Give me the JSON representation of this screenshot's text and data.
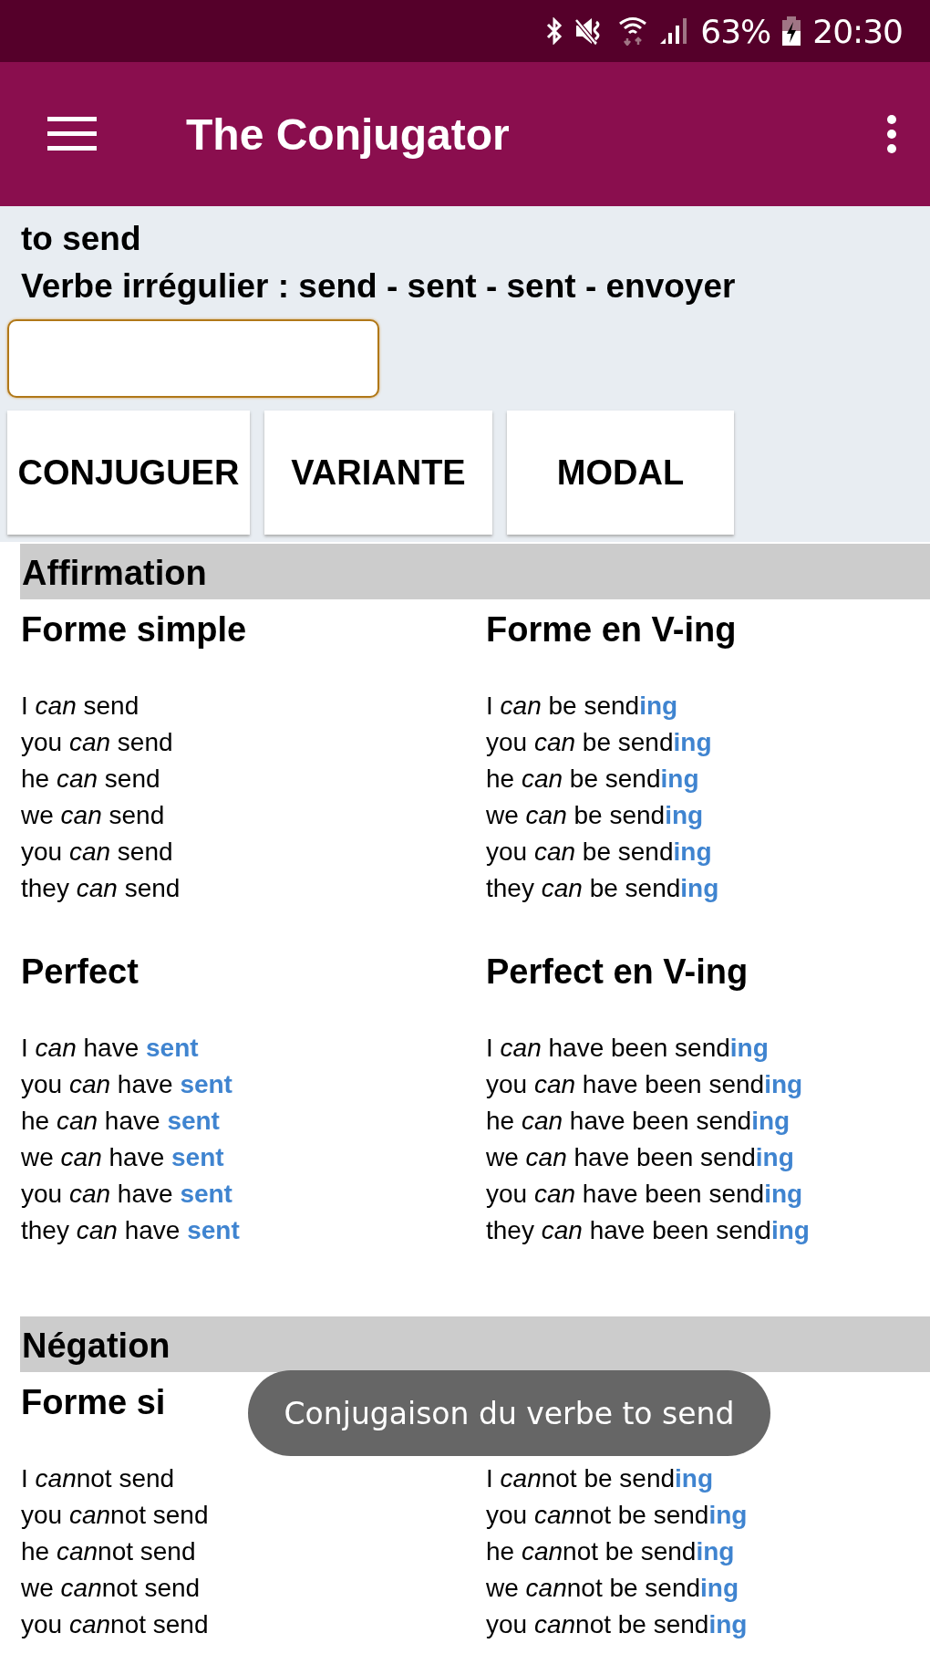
{
  "status_bar": {
    "battery": "63%",
    "time": "20:30"
  },
  "app_bar": {
    "title": "The Conjugator"
  },
  "verb": {
    "title": "to send",
    "info": "Verbe irrégulier : send - sent - sent - envoyer"
  },
  "buttons": [
    "CONJUGUER",
    "VARIANTE",
    "MODAL"
  ],
  "sections": [
    {
      "title": "Affirmation",
      "tenses": [
        {
          "title": "Forme simple",
          "lines": [
            [
              {
                "text": "I "
              },
              {
                "text": "can",
                "kind": "modal"
              },
              {
                "text": " send"
              }
            ],
            [
              {
                "text": "you "
              },
              {
                "text": "can",
                "kind": "modal"
              },
              {
                "text": " send"
              }
            ],
            [
              {
                "text": "he "
              },
              {
                "text": "can",
                "kind": "modal"
              },
              {
                "text": " send"
              }
            ],
            [
              {
                "text": "we "
              },
              {
                "text": "can",
                "kind": "modal"
              },
              {
                "text": " send"
              }
            ],
            [
              {
                "text": "you "
              },
              {
                "text": "can",
                "kind": "modal"
              },
              {
                "text": " send"
              }
            ],
            [
              {
                "text": "they "
              },
              {
                "text": "can",
                "kind": "modal"
              },
              {
                "text": " send"
              }
            ]
          ]
        },
        {
          "title": "Forme en V-ing",
          "lines": [
            [
              {
                "text": "I "
              },
              {
                "text": "can",
                "kind": "modal"
              },
              {
                "text": " be send"
              },
              {
                "text": "ing",
                "kind": "ending"
              }
            ],
            [
              {
                "text": "you "
              },
              {
                "text": "can",
                "kind": "modal"
              },
              {
                "text": " be send"
              },
              {
                "text": "ing",
                "kind": "ending"
              }
            ],
            [
              {
                "text": "he "
              },
              {
                "text": "can",
                "kind": "modal"
              },
              {
                "text": " be send"
              },
              {
                "text": "ing",
                "kind": "ending"
              }
            ],
            [
              {
                "text": "we "
              },
              {
                "text": "can",
                "kind": "modal"
              },
              {
                "text": " be send"
              },
              {
                "text": "ing",
                "kind": "ending"
              }
            ],
            [
              {
                "text": "you "
              },
              {
                "text": "can",
                "kind": "modal"
              },
              {
                "text": " be send"
              },
              {
                "text": "ing",
                "kind": "ending"
              }
            ],
            [
              {
                "text": "they "
              },
              {
                "text": "can",
                "kind": "modal"
              },
              {
                "text": " be send"
              },
              {
                "text": "ing",
                "kind": "ending"
              }
            ]
          ]
        },
        {
          "title": "Perfect",
          "lines": [
            [
              {
                "text": "I "
              },
              {
                "text": "can",
                "kind": "modal"
              },
              {
                "text": " have "
              },
              {
                "text": "sent",
                "kind": "ending"
              }
            ],
            [
              {
                "text": "you "
              },
              {
                "text": "can",
                "kind": "modal"
              },
              {
                "text": " have "
              },
              {
                "text": "sent",
                "kind": "ending"
              }
            ],
            [
              {
                "text": "he "
              },
              {
                "text": "can",
                "kind": "modal"
              },
              {
                "text": " have "
              },
              {
                "text": "sent",
                "kind": "ending"
              }
            ],
            [
              {
                "text": "we "
              },
              {
                "text": "can",
                "kind": "modal"
              },
              {
                "text": " have "
              },
              {
                "text": "sent",
                "kind": "ending"
              }
            ],
            [
              {
                "text": "you "
              },
              {
                "text": "can",
                "kind": "modal"
              },
              {
                "text": " have "
              },
              {
                "text": "sent",
                "kind": "ending"
              }
            ],
            [
              {
                "text": "they "
              },
              {
                "text": "can",
                "kind": "modal"
              },
              {
                "text": " have "
              },
              {
                "text": "sent",
                "kind": "ending"
              }
            ]
          ]
        },
        {
          "title": "Perfect en V-ing",
          "lines": [
            [
              {
                "text": "I "
              },
              {
                "text": "can",
                "kind": "modal"
              },
              {
                "text": " have been send"
              },
              {
                "text": "ing",
                "kind": "ending"
              }
            ],
            [
              {
                "text": "you "
              },
              {
                "text": "can",
                "kind": "modal"
              },
              {
                "text": " have been send"
              },
              {
                "text": "ing",
                "kind": "ending"
              }
            ],
            [
              {
                "text": "he "
              },
              {
                "text": "can",
                "kind": "modal"
              },
              {
                "text": " have been send"
              },
              {
                "text": "ing",
                "kind": "ending"
              }
            ],
            [
              {
                "text": "we "
              },
              {
                "text": "can",
                "kind": "modal"
              },
              {
                "text": " have been send"
              },
              {
                "text": "ing",
                "kind": "ending"
              }
            ],
            [
              {
                "text": "you "
              },
              {
                "text": "can",
                "kind": "modal"
              },
              {
                "text": " have been send"
              },
              {
                "text": "ing",
                "kind": "ending"
              }
            ],
            [
              {
                "text": "they "
              },
              {
                "text": "can",
                "kind": "modal"
              },
              {
                "text": " have been send"
              },
              {
                "text": "ing",
                "kind": "ending"
              }
            ]
          ]
        }
      ]
    },
    {
      "title": "Négation",
      "tenses": [
        {
          "title": "Forme si",
          "lines": [
            [
              {
                "text": "I "
              },
              {
                "text": "can",
                "kind": "modal"
              },
              {
                "text": "not send"
              }
            ],
            [
              {
                "text": "you "
              },
              {
                "text": "can",
                "kind": "modal"
              },
              {
                "text": "not send"
              }
            ],
            [
              {
                "text": "he "
              },
              {
                "text": "can",
                "kind": "modal"
              },
              {
                "text": "not send"
              }
            ],
            [
              {
                "text": "we "
              },
              {
                "text": "can",
                "kind": "modal"
              },
              {
                "text": "not send"
              }
            ],
            [
              {
                "text": "you "
              },
              {
                "text": "can",
                "kind": "modal"
              },
              {
                "text": "not send"
              }
            ]
          ]
        },
        {
          "lines": [
            [
              {
                "text": "I "
              },
              {
                "text": "can",
                "kind": "modal"
              },
              {
                "text": "not be send"
              },
              {
                "text": "ing",
                "kind": "ending"
              }
            ],
            [
              {
                "text": "you "
              },
              {
                "text": "can",
                "kind": "modal"
              },
              {
                "text": "not be send"
              },
              {
                "text": "ing",
                "kind": "ending"
              }
            ],
            [
              {
                "text": "he "
              },
              {
                "text": "can",
                "kind": "modal"
              },
              {
                "text": "not be send"
              },
              {
                "text": "ing",
                "kind": "ending"
              }
            ],
            [
              {
                "text": "we "
              },
              {
                "text": "can",
                "kind": "modal"
              },
              {
                "text": "not be send"
              },
              {
                "text": "ing",
                "kind": "ending"
              }
            ],
            [
              {
                "text": "you "
              },
              {
                "text": "can",
                "kind": "modal"
              },
              {
                "text": "not be send"
              },
              {
                "text": "ing",
                "kind": "ending"
              }
            ]
          ]
        }
      ]
    }
  ],
  "toast": {
    "text": "Conjugaison du verbe to send"
  }
}
